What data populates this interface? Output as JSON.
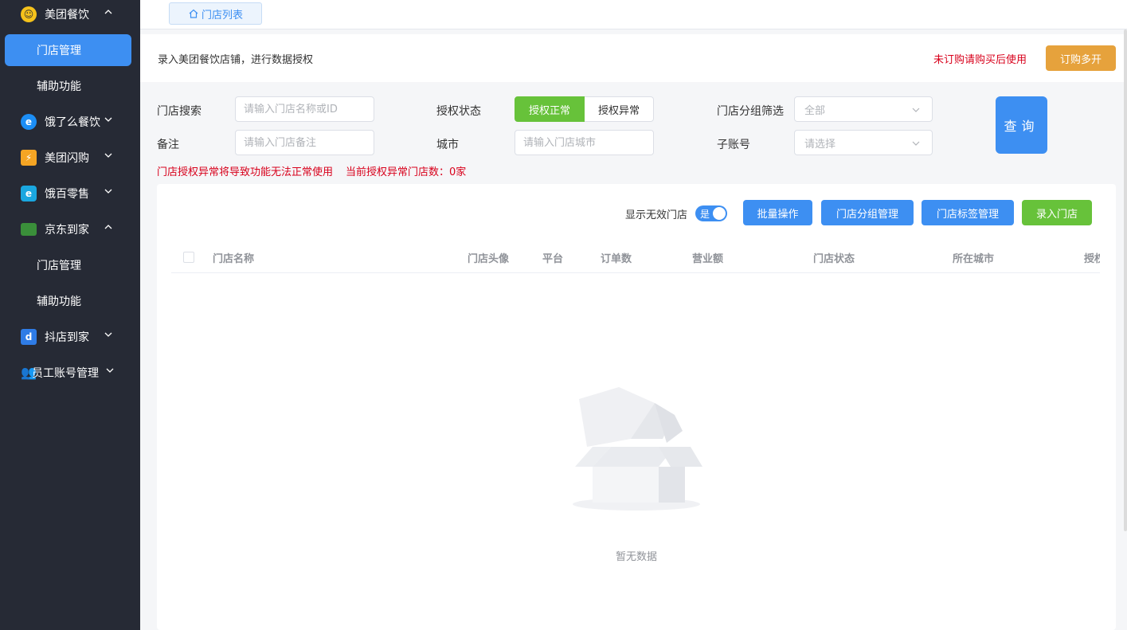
{
  "sidebar": {
    "groups": [
      {
        "label": "美团餐饮",
        "icon": "meituan-icon",
        "color": "#f5c21b",
        "expanded": true
      },
      {
        "label": "饿了么餐饮",
        "icon": "eleme-icon",
        "color": "#1c8ef5",
        "expanded": false
      },
      {
        "label": "美团闪购",
        "icon": "lightning-icon",
        "color": "#f5a524",
        "expanded": false
      },
      {
        "label": "饿百零售",
        "icon": "elebai-icon",
        "color": "#1aa7e0",
        "expanded": false
      },
      {
        "label": "京东到家",
        "icon": "jd-icon",
        "color": "#3a8f3a",
        "expanded": true
      },
      {
        "label": "抖店到家",
        "icon": "douyin-icon",
        "color": "#2f7ce6",
        "expanded": false
      },
      {
        "label": "员工账号管理",
        "icon": "users-icon",
        "color": "#4a90e2",
        "expanded": false
      }
    ],
    "subs": [
      {
        "label": "门店管理",
        "active": true
      },
      {
        "label": "辅助功能",
        "active": false
      },
      {
        "label": "门店管理",
        "active": false
      },
      {
        "label": "辅助功能",
        "active": false
      }
    ]
  },
  "tab": {
    "label": "门店列表"
  },
  "notice": {
    "description": "录入美团餐饮店铺，进行数据授权",
    "warning": "未订购请购买后使用",
    "buy_button": "订购多开"
  },
  "filters": {
    "search": {
      "label": "门店搜索",
      "placeholder": "请输入门店名称或ID"
    },
    "remark": {
      "label": "备注",
      "placeholder": "请输入门店备注"
    },
    "auth": {
      "label": "授权状态",
      "options": [
        "授权正常",
        "授权异常"
      ],
      "selected": "授权正常"
    },
    "city": {
      "label": "城市",
      "placeholder": "请输入门店城市"
    },
    "group": {
      "label": "门店分组筛选",
      "value": "全部"
    },
    "subaccount": {
      "label": "子账号",
      "value": "请选择"
    },
    "query_button": "查询"
  },
  "alerts": {
    "auth_warning": "门店授权异常将导致功能无法正常使用",
    "abnormal_count": "当前授权异常门店数：0家"
  },
  "toolbar": {
    "show_invalid_label": "显示无效门店",
    "switch_text": "是",
    "batch": "批量操作",
    "group_manage": "门店分组管理",
    "tag_manage": "门店标签管理",
    "add_store": "录入门店"
  },
  "table": {
    "columns": [
      "门店名称",
      "门店头像",
      "平台",
      "订单数",
      "营业额",
      "门店状态",
      "所在城市",
      "授权"
    ],
    "empty_text": "暂无数据"
  },
  "colors": {
    "primary": "#3d8ff2",
    "success": "#67c23a",
    "warning": "#e6a23c",
    "danger": "#d8001b",
    "sidebar_bg": "#262a35"
  }
}
